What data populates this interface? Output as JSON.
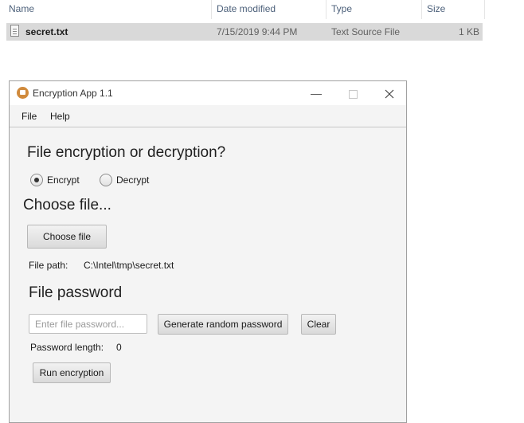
{
  "explorer": {
    "columns": {
      "name": "Name",
      "date_modified": "Date modified",
      "type": "Type",
      "size": "Size"
    },
    "files": [
      {
        "name": "secret.txt",
        "date_modified": "7/15/2019 9:44 PM",
        "type": "Text Source File",
        "size": "1 KB"
      }
    ]
  },
  "app": {
    "title": "Encryption App 1.1",
    "menu": [
      "File",
      "Help"
    ],
    "mode_heading": "File encryption or decryption?",
    "mode_options": [
      {
        "label": "Encrypt",
        "selected": true
      },
      {
        "label": "Decrypt",
        "selected": false
      }
    ],
    "choose_heading": "Choose file...",
    "choose_button": "Choose file",
    "file_path_label": "File path:",
    "file_path_value": "C:\\Intel\\tmp\\secret.txt",
    "password_heading": "File password",
    "password_placeholder": "Enter file password...",
    "password_value": "",
    "generate_button": "Generate random password",
    "clear_button": "Clear",
    "password_length_label": "Password length:",
    "password_length_value": "0",
    "run_button": "Run encryption"
  }
}
